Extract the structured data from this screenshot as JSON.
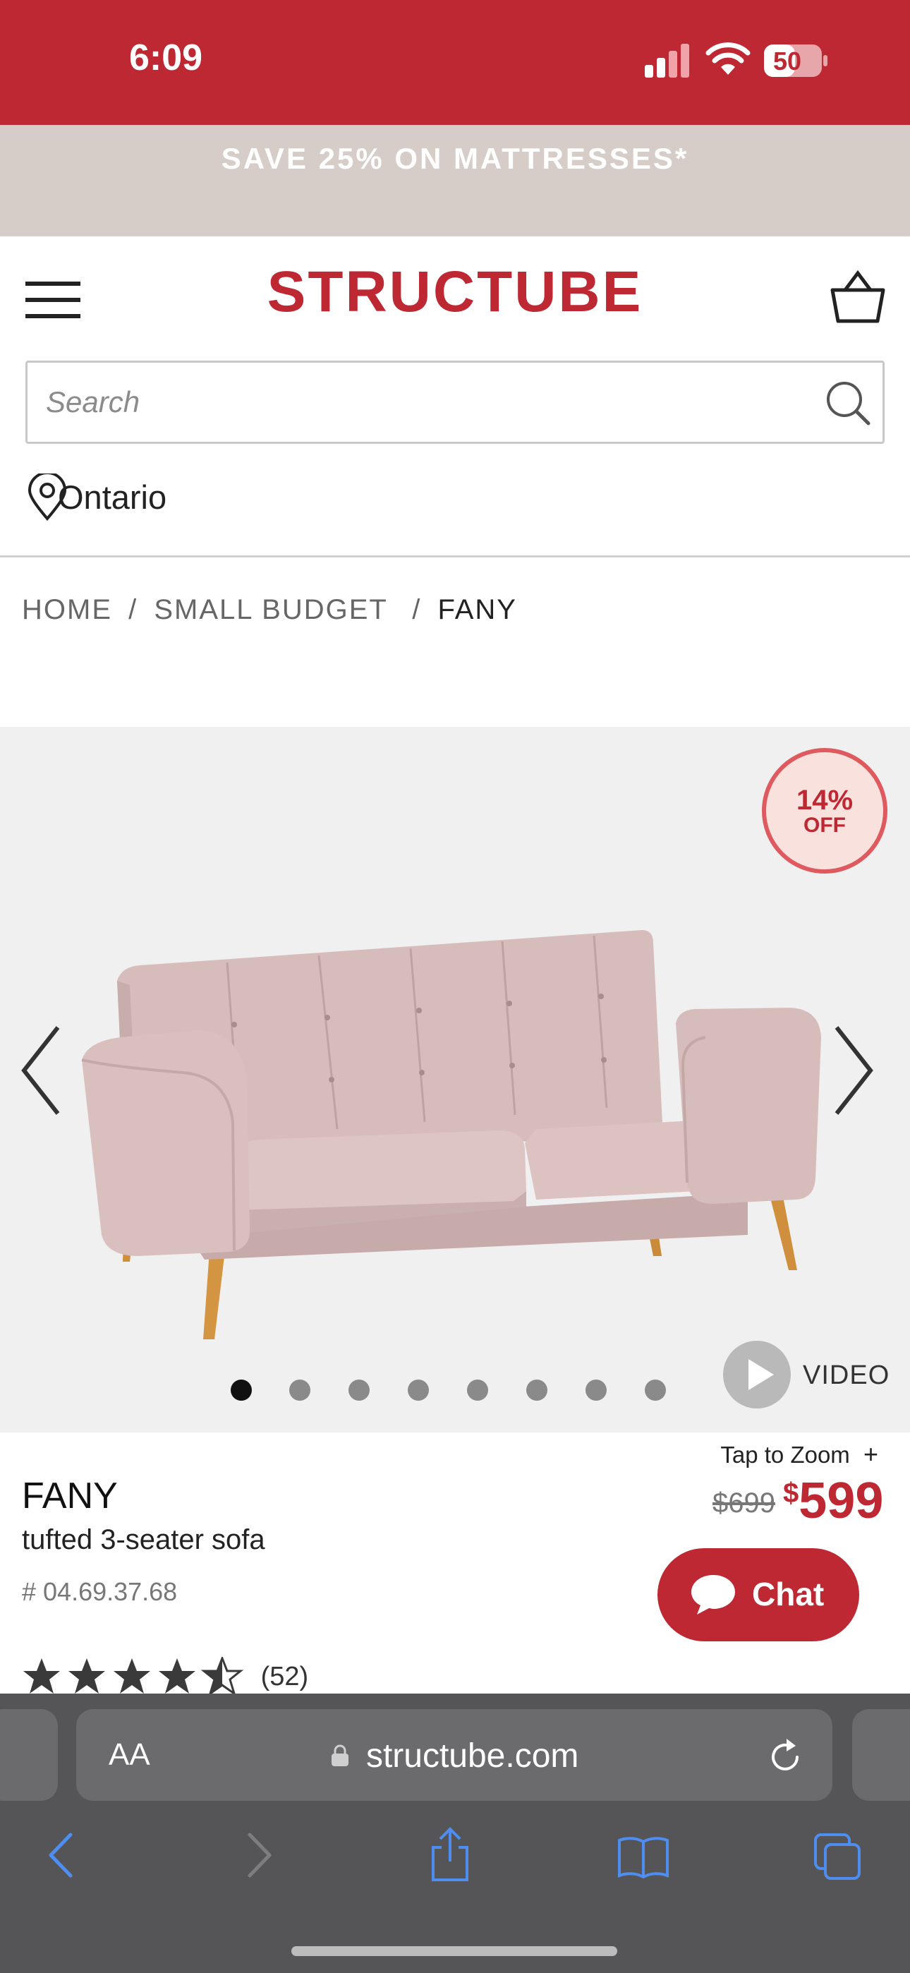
{
  "status_bar": {
    "time": "6:09",
    "battery": "50"
  },
  "promo": {
    "text": "SAVE 25% ON MATTRESSES*"
  },
  "header": {
    "logo": "STRUCTUBE",
    "search_placeholder": "Search",
    "location": "Ontario"
  },
  "breadcrumb": {
    "home": "HOME",
    "sep1": "/",
    "category": "SMALL BUDGET",
    "sep2": "/",
    "current": "FANY"
  },
  "gallery": {
    "badge_percent": "14%",
    "badge_off": "OFF",
    "video_label": "VIDEO",
    "dots_total": 8,
    "dots_active_index": 0
  },
  "product": {
    "name": "FANY",
    "description": "tufted 3-seater sofa",
    "sku": "# 04.69.37.68",
    "tap_zoom": "Tap to Zoom",
    "old_price": "$699",
    "price_symbol": "$",
    "price": "599",
    "rating_value": 4.5,
    "rating_count": "(52)"
  },
  "chat": {
    "label": "Chat"
  },
  "browser": {
    "aa": "AA",
    "url": "structube.com"
  },
  "colors": {
    "brand_red": "#be2833",
    "promo_bg": "#d7cdc8",
    "safari_bar": "#555557",
    "safari_blue": "#4d8ef0"
  }
}
